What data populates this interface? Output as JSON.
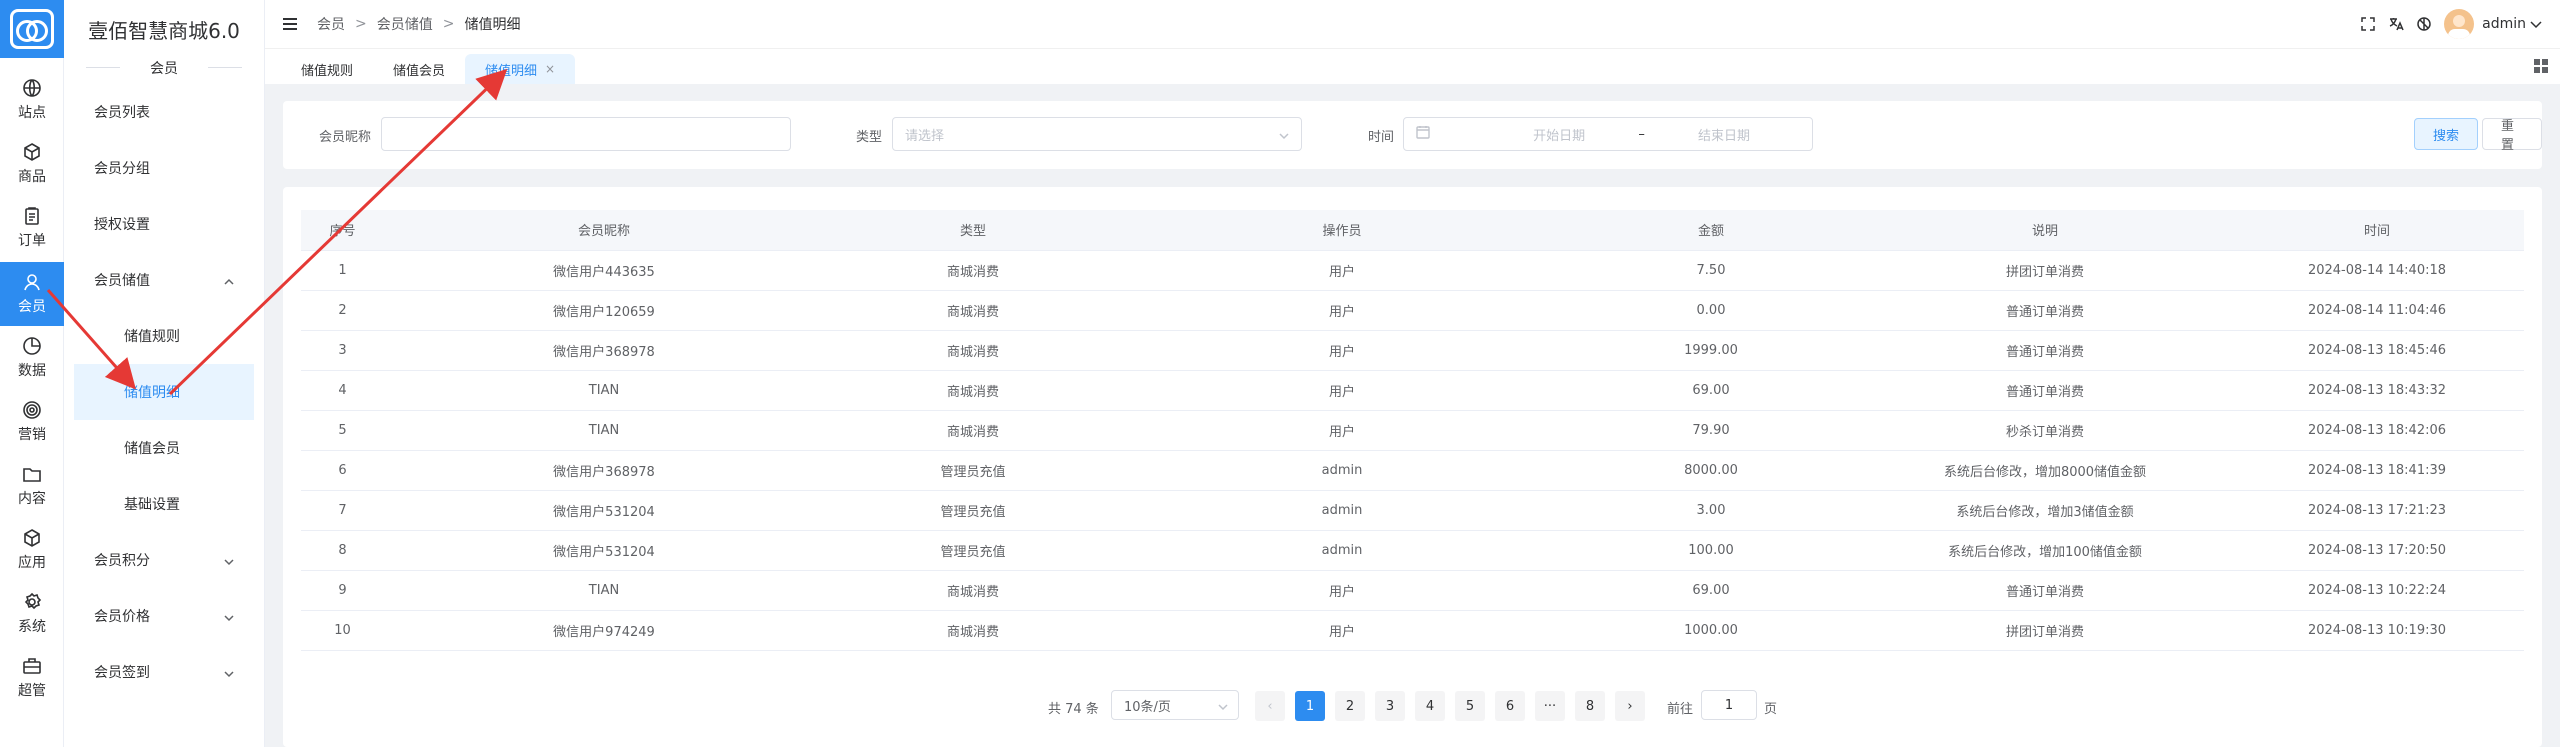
{
  "app": {
    "brand": "壹佰智慧商城6.0",
    "section": "会员"
  },
  "rail": [
    {
      "label": "站点",
      "icon": "globe-icon"
    },
    {
      "label": "商品",
      "icon": "box-icon"
    },
    {
      "label": "订单",
      "icon": "clipboard-icon"
    },
    {
      "label": "会员",
      "icon": "user-icon",
      "active": true
    },
    {
      "label": "数据",
      "icon": "pie-chart-icon"
    },
    {
      "label": "营销",
      "icon": "target-icon"
    },
    {
      "label": "内容",
      "icon": "folder-icon"
    },
    {
      "label": "应用",
      "icon": "cube-icon"
    },
    {
      "label": "系统",
      "icon": "settings-icon"
    },
    {
      "label": "超管",
      "icon": "briefcase-icon"
    }
  ],
  "sidebar": {
    "member_list": "会员列表",
    "member_group": "会员分组",
    "auth_settings": "授权设置",
    "stored_value": "会员储值",
    "sub": {
      "rules": "储值规则",
      "details": "储值明细",
      "members": "储值会员",
      "basic": "基础设置"
    },
    "points": "会员积分",
    "price": "会员价格",
    "checkin": "会员签到"
  },
  "header": {
    "breadcrumb": [
      "会员",
      "会员储值",
      "储值明细"
    ],
    "separator": ">",
    "username": "admin"
  },
  "tabs": [
    {
      "label": "储值规则"
    },
    {
      "label": "储值会员"
    },
    {
      "label": "储值明细",
      "active": true,
      "close": "×"
    }
  ],
  "filter": {
    "nickname_label": "会员昵称",
    "nickname_value": "",
    "type_label": "类型",
    "type_placeholder": "请选择",
    "time_label": "时间",
    "start_placeholder": "开始日期",
    "range_sep": "–",
    "end_placeholder": "结束日期",
    "search_btn": "搜索",
    "reset_btn": "重置"
  },
  "table": {
    "columns": [
      "序号",
      "会员昵称",
      "类型",
      "操作员",
      "金额",
      "说明",
      "时间"
    ],
    "rows": [
      [
        "1",
        "微信用户443635",
        "商城消费",
        "用户",
        "7.50",
        "拼团订单消费",
        "2024-08-14 14:40:18"
      ],
      [
        "2",
        "微信用户120659",
        "商城消费",
        "用户",
        "0.00",
        "普通订单消费",
        "2024-08-14 11:04:46"
      ],
      [
        "3",
        "微信用户368978",
        "商城消费",
        "用户",
        "1999.00",
        "普通订单消费",
        "2024-08-13 18:45:46"
      ],
      [
        "4",
        "TIAN",
        "商城消费",
        "用户",
        "69.00",
        "普通订单消费",
        "2024-08-13 18:43:32"
      ],
      [
        "5",
        "TIAN",
        "商城消费",
        "用户",
        "79.90",
        "秒杀订单消费",
        "2024-08-13 18:42:06"
      ],
      [
        "6",
        "微信用户368978",
        "管理员充值",
        "admin",
        "8000.00",
        "系统后台修改，增加8000储值金额",
        "2024-08-13 18:41:39"
      ],
      [
        "7",
        "微信用户531204",
        "管理员充值",
        "admin",
        "3.00",
        "系统后台修改，增加3储值金额",
        "2024-08-13 17:21:23"
      ],
      [
        "8",
        "微信用户531204",
        "管理员充值",
        "admin",
        "100.00",
        "系统后台修改，增加100储值金额",
        "2024-08-13 17:20:50"
      ],
      [
        "9",
        "TIAN",
        "商城消费",
        "用户",
        "69.00",
        "普通订单消费",
        "2024-08-13 10:22:24"
      ],
      [
        "10",
        "微信用户974249",
        "商城消费",
        "用户",
        "1000.00",
        "拼团订单消费",
        "2024-08-13 10:19:30"
      ]
    ]
  },
  "pagination": {
    "total": "共 74 条",
    "page_size": "10条/页",
    "prev": "‹",
    "pages": [
      "1",
      "2",
      "3",
      "4",
      "5",
      "6",
      "···",
      "8"
    ],
    "current": "1",
    "next": "›",
    "goto_label": "前往",
    "goto_value": "1",
    "goto_unit": "页"
  },
  "colors": {
    "accent": "#2d8cf0",
    "annotation": "#e53935"
  }
}
